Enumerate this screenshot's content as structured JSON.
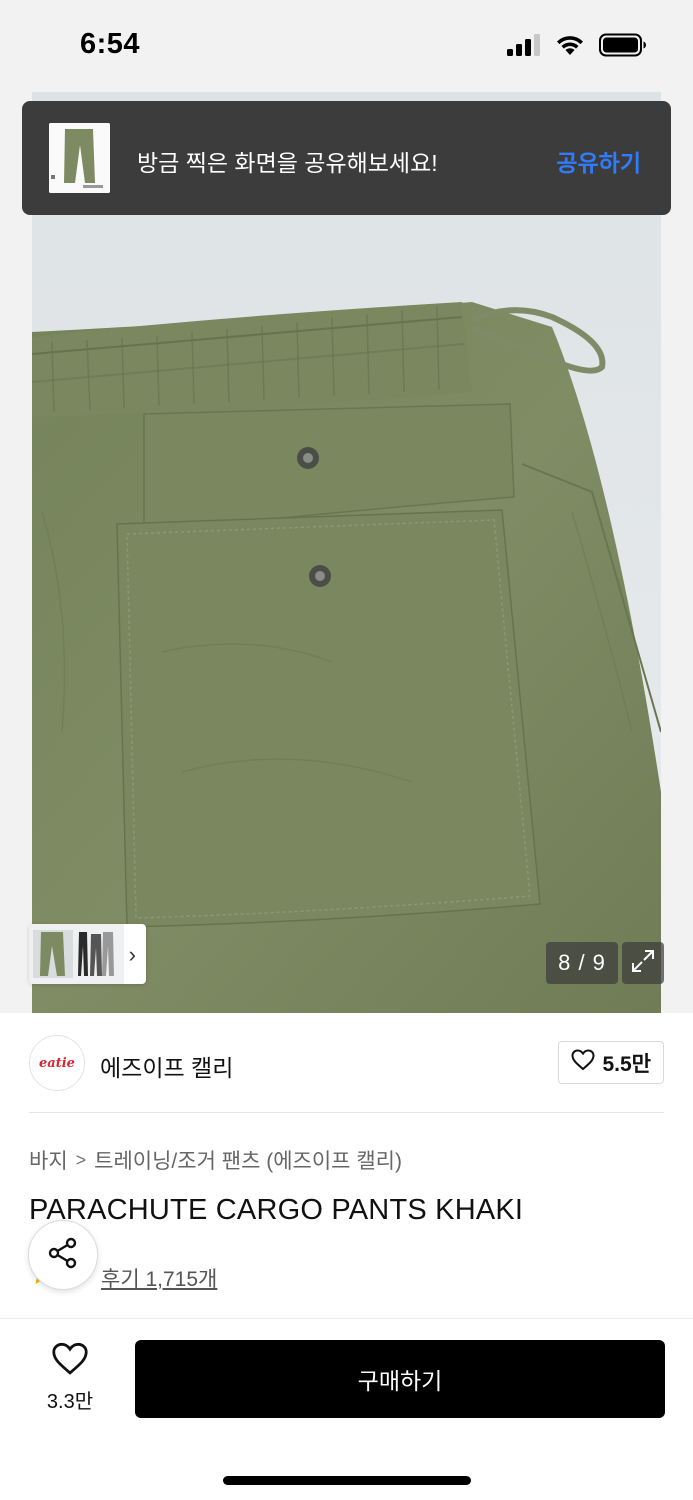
{
  "status_bar": {
    "time": "6:54",
    "icons": [
      "cellular-signal-icon",
      "wifi-icon",
      "battery-icon"
    ]
  },
  "toast": {
    "message": "방금 찍은 화면을 공유해보세요!",
    "action_label": "공유하기",
    "action_color": "#2f7cff",
    "background": "#3c3c3c"
  },
  "gallery": {
    "current": 8,
    "total": 9,
    "counter_text": "8 / 9",
    "product_color": "#7d8a62",
    "thumbnail_chevron": "›"
  },
  "brand": {
    "logo_text": "eatie",
    "name": "에즈이프 캘리",
    "likes": "5.5만"
  },
  "breadcrumb": {
    "items": [
      "바지",
      "트레이닝/조거 팬츠 (에즈이프 캘리)"
    ],
    "separator": ">"
  },
  "product": {
    "title": "PARACHUTE CARGO PANTS KHAKI",
    "review_text": "후기 1,715개"
  },
  "bottom_bar": {
    "wish_count": "3.3만",
    "buy_label": "구매하기",
    "buy_color": "#000000"
  }
}
